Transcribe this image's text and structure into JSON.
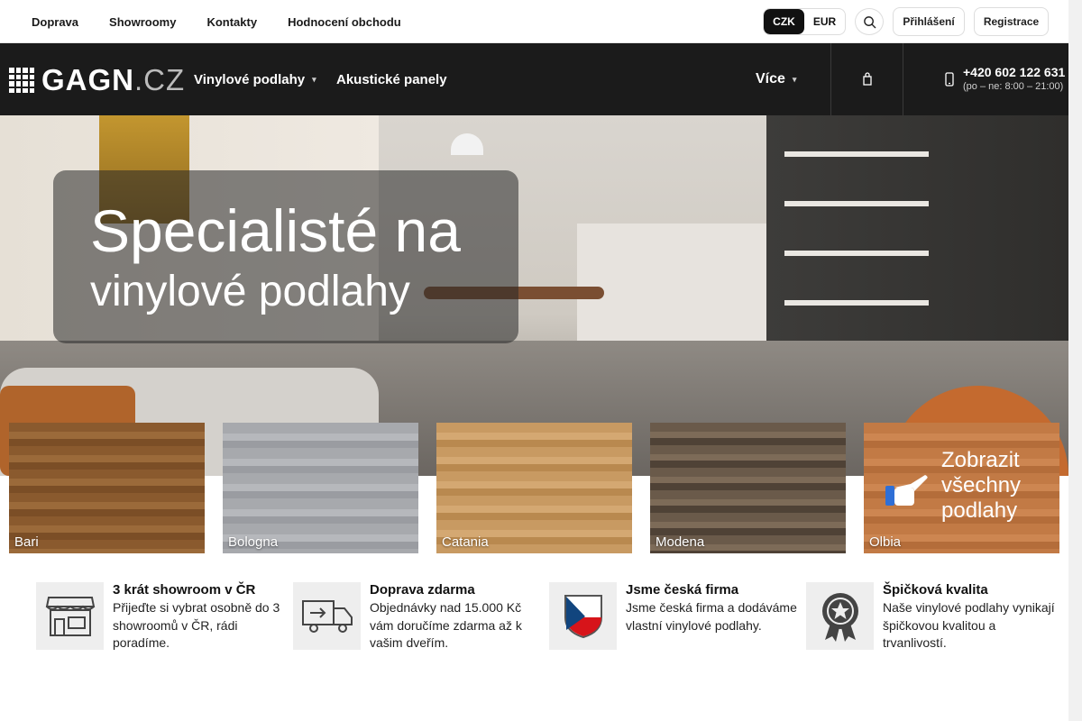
{
  "topbar": {
    "links": [
      "Doprava",
      "Showroomy",
      "Kontakty",
      "Hodnocení obchodu"
    ],
    "currency": {
      "active": "CZK",
      "other": "EUR"
    },
    "login": "Přihlášení",
    "register": "Registrace"
  },
  "header": {
    "logo_main": "GAGN",
    "logo_tld": ".CZ",
    "nav": {
      "vinyl": "Vinylové podlahy",
      "acoustic": "Akustické panely",
      "more": "Více"
    },
    "phone": {
      "number": "+420 602 122 631",
      "hours": "(po – ne: 8:00 – 21:00)"
    }
  },
  "hero": {
    "headline_1": "Specialisté na",
    "headline_2": "vinylové podlahy"
  },
  "tiles": [
    {
      "name": "Bari",
      "color": "#8a5a2e"
    },
    {
      "name": "Bologna",
      "color": "#a7a9ad"
    },
    {
      "name": "Catania",
      "color": "#c89a62"
    },
    {
      "name": "Modena",
      "color": "#6a5a4a"
    },
    {
      "name": "Olbia",
      "color": "#c27a45"
    }
  ],
  "tiles_cta": [
    "Zobrazit",
    "všechny",
    "podlahy"
  ],
  "features": [
    {
      "title": "3 krát showroom v ČR",
      "desc": "Přijeďte si vybrat osobně do 3 showroomů v ČR, rádi poradíme.",
      "icon": "store-icon"
    },
    {
      "title": "Doprava zdarma",
      "desc": "Objednávky nad 15.000 Kč vám doručíme zdarma až k vašim dveřím.",
      "icon": "truck-icon"
    },
    {
      "title": "Jsme česká firma",
      "desc": "Jsme česká firma a dodáváme vlastní vinylové podlahy.",
      "icon": "czech-flag-shield-icon"
    },
    {
      "title": "Špičková kvalita",
      "desc": "Naše vinylové podlahy vynikají špičkovou kvalitou a trvanlivostí.",
      "icon": "quality-badge-icon"
    }
  ],
  "colors": {
    "nav_bg": "#1b1b1b",
    "accent_cta": "#2f6fd6"
  }
}
